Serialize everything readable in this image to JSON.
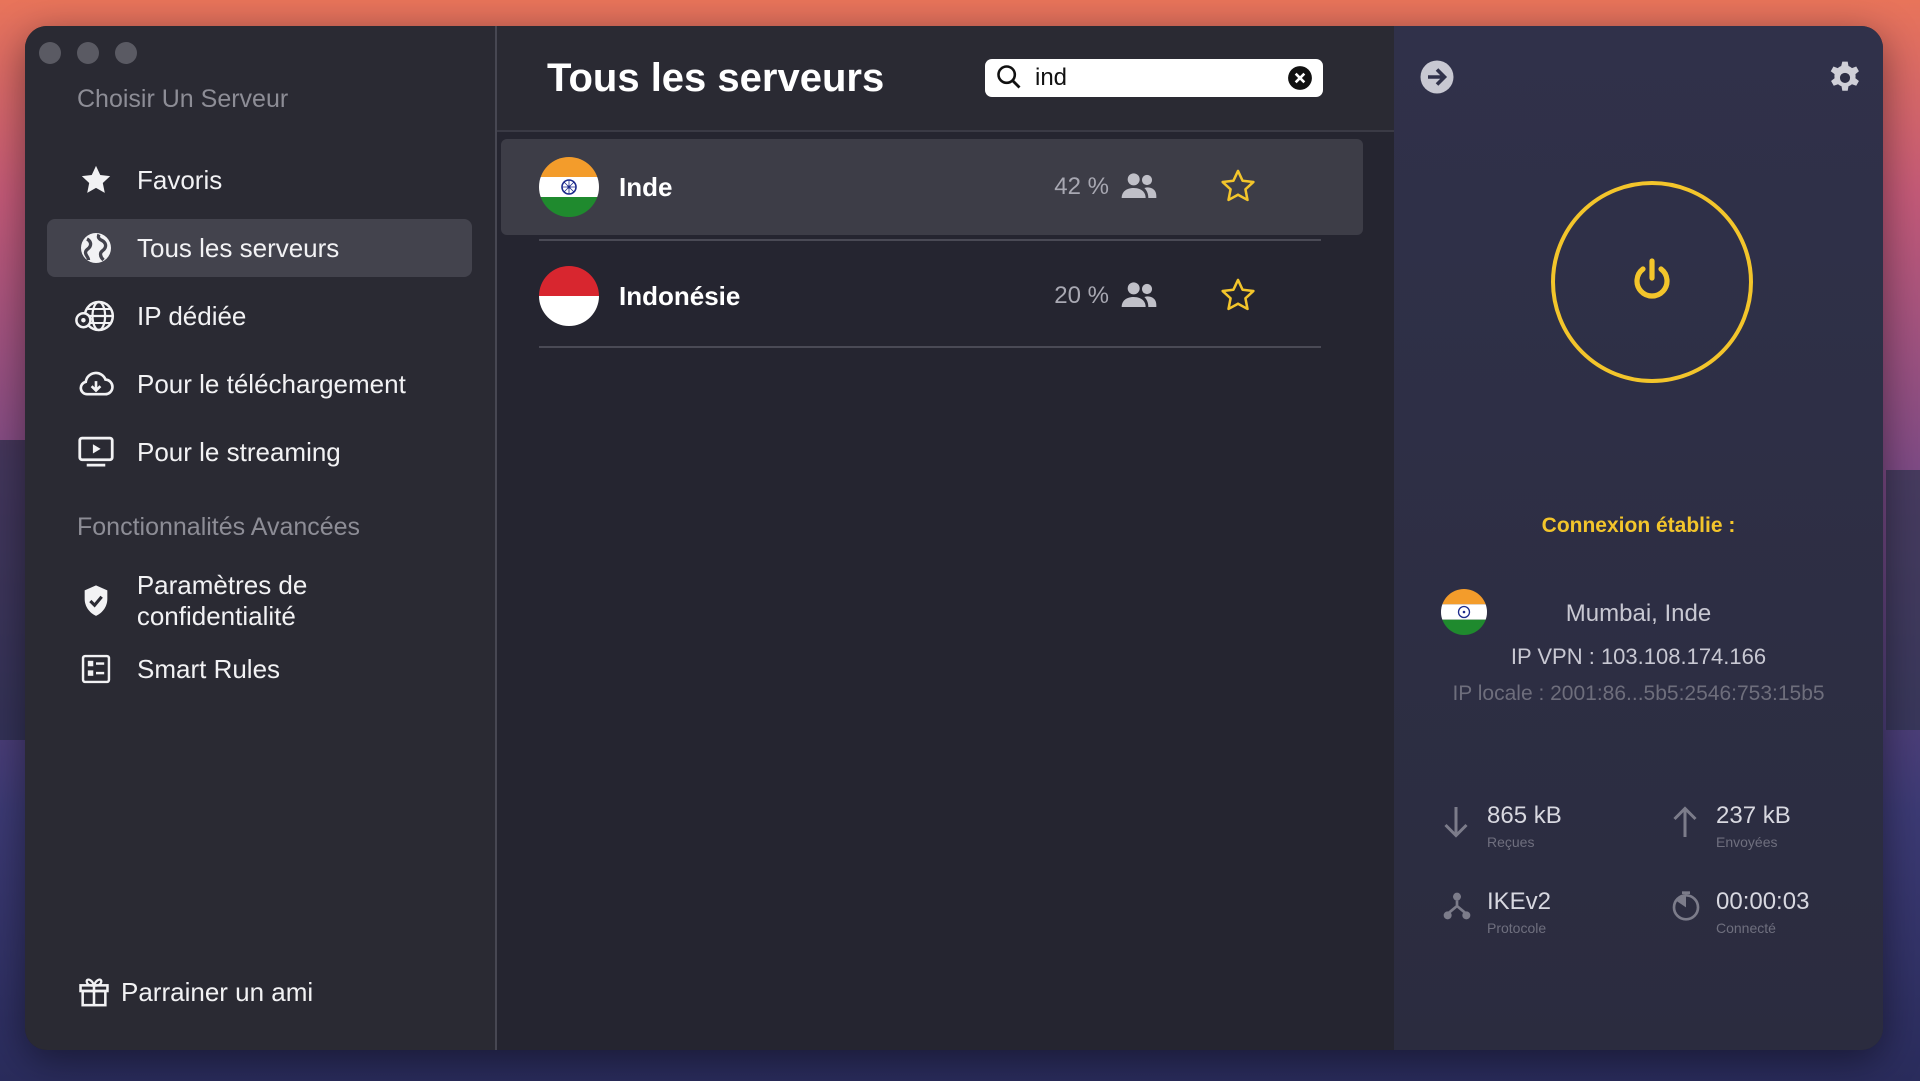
{
  "sidebar": {
    "section1_label": "Choisir Un Serveur",
    "items": [
      {
        "label": "Favoris",
        "icon": "star-icon"
      },
      {
        "label": "Tous les serveurs",
        "icon": "globe-icon",
        "active": true
      },
      {
        "label": "IP dédiée",
        "icon": "dedicated-ip-icon"
      },
      {
        "label": "Pour le téléchargement",
        "icon": "cloud-download-icon"
      },
      {
        "label": "Pour le streaming",
        "icon": "streaming-icon"
      }
    ],
    "section2_label": "Fonctionnalités Avancées",
    "advanced_items": [
      {
        "label": "Paramètres de confidentialité",
        "icon": "shield-icon"
      },
      {
        "label": "Smart Rules",
        "icon": "smart-rules-icon"
      }
    ],
    "referral_label": "Parrainer un ami"
  },
  "main": {
    "title": "Tous les serveurs",
    "search": {
      "value": "ind",
      "placeholder": ""
    },
    "servers": [
      {
        "name": "Inde",
        "load": "42 %",
        "selected": true
      },
      {
        "name": "Indonésie",
        "load": "20 %",
        "selected": false
      }
    ]
  },
  "panel": {
    "status": "Connexion établie :",
    "location": "Mumbai, Inde",
    "vpn_ip": "IP VPN : 103.108.174.166",
    "local_ip": "IP locale : 2001:86...5b5:2546:753:15b5",
    "stats": {
      "received": {
        "value": "865 kB",
        "label": "Reçues"
      },
      "sent": {
        "value": "237 kB",
        "label": "Envoyées"
      },
      "protocol": {
        "value": "IKEv2",
        "label": "Protocole"
      },
      "duration": {
        "value": "00:00:03",
        "label": "Connecté"
      }
    }
  },
  "colors": {
    "accent": "#f3c52b",
    "window_bg": "#25252f",
    "sidebar_bg": "#2a2a33",
    "selected_row": "#3d3d47"
  }
}
